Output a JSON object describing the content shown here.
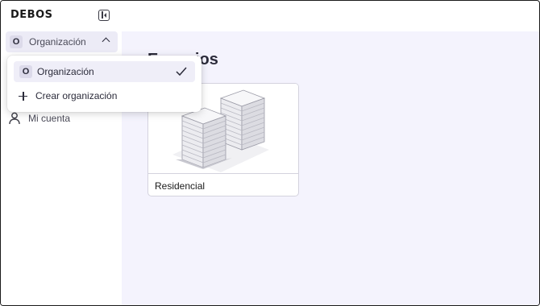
{
  "app": {
    "logo": "DEBOS"
  },
  "sidebar": {
    "org_switcher": {
      "avatar": "O",
      "name": "Organización",
      "icon": "chevron-up-icon"
    },
    "items": [
      {
        "label": "Mi cuenta",
        "icon": "user-icon"
      }
    ],
    "collapse_icon": "sidebar-collapse-icon"
  },
  "dropdown": {
    "items": [
      {
        "avatar": "O",
        "label": "Organización",
        "selected": true,
        "icon": "checkmark-icon"
      },
      {
        "label": "Crear organización",
        "icon": "plus-icon"
      }
    ]
  },
  "main": {
    "title": "Espacios",
    "cards": [
      {
        "label": "Residencial",
        "image": "buildings-illustration"
      }
    ]
  },
  "colors": {
    "main_bg": "#f4f3fd",
    "active_bg": "#ecebf6"
  }
}
